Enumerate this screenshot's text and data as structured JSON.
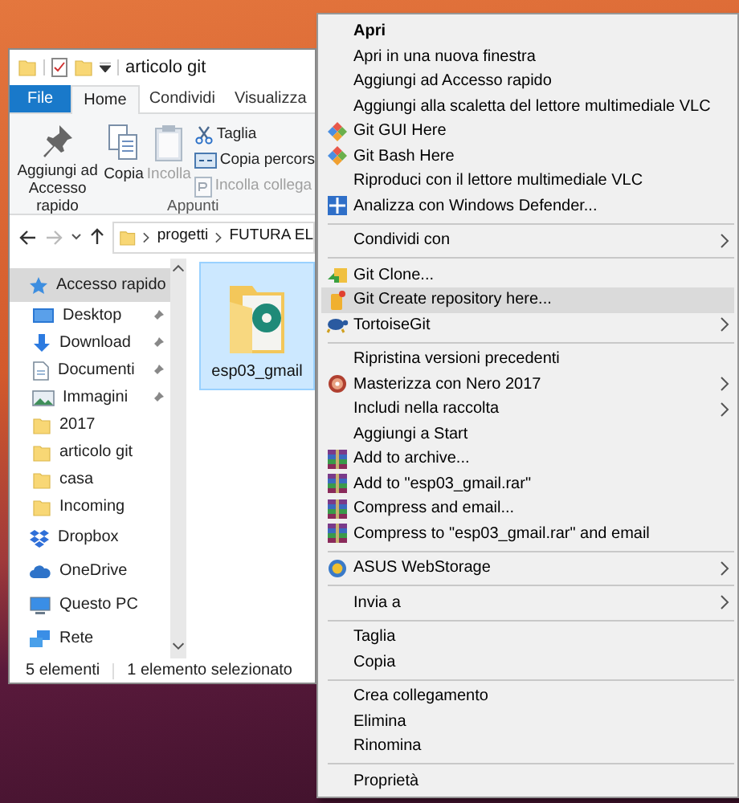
{
  "window": {
    "title": "articolo git"
  },
  "ribbon_tabs": [
    {
      "label": "File",
      "kind": "file",
      "selected": false
    },
    {
      "label": "Home",
      "kind": "tab",
      "selected": true
    },
    {
      "label": "Condividi",
      "kind": "tab",
      "selected": false
    },
    {
      "label": "Visualizza",
      "kind": "tab",
      "selected": false
    }
  ],
  "clipboard_group": {
    "label": "Appunti",
    "buttons": [
      {
        "label": "Aggiungi ad Accesso rapido",
        "kind": "pin",
        "disabled": false
      },
      {
        "label": "Copia",
        "kind": "copy",
        "disabled": false
      },
      {
        "label": "Incolla",
        "kind": "paste",
        "disabled": true
      }
    ],
    "small_buttons": [
      {
        "label": "Taglia",
        "kind": "cut",
        "disabled": false
      },
      {
        "label": "Copia percors",
        "kind": "path",
        "disabled": false
      },
      {
        "label": "Incolla collega",
        "kind": "shortcut",
        "disabled": true
      }
    ]
  },
  "address_bar": {
    "crumbs": [
      "progetti",
      "FUTURA EL"
    ]
  },
  "navigation": [
    {
      "label": "Accesso rapido",
      "kind": "star",
      "selected": true,
      "children": [
        {
          "label": "Desktop",
          "kind": "desktop",
          "pinned": true,
          "selected": false
        },
        {
          "label": "Download",
          "kind": "download",
          "pinned": true,
          "selected": false
        },
        {
          "label": "Documenti",
          "kind": "document",
          "pinned": true,
          "selected": false
        },
        {
          "label": "Immagini",
          "kind": "picture",
          "pinned": true,
          "selected": false
        },
        {
          "label": "2017",
          "kind": "folder",
          "pinned": false,
          "selected": false
        },
        {
          "label": "articolo git",
          "kind": "folder",
          "pinned": false,
          "selected": false
        },
        {
          "label": "casa",
          "kind": "folder",
          "pinned": false,
          "selected": false
        },
        {
          "label": "Incoming",
          "kind": "folder",
          "pinned": false,
          "selected": false
        }
      ]
    },
    {
      "label": "Dropbox",
      "kind": "dropbox",
      "selected": false
    },
    {
      "label": "OneDrive",
      "kind": "cloud",
      "selected": false
    },
    {
      "label": "Questo PC",
      "kind": "computer",
      "selected": false
    },
    {
      "label": "Rete",
      "kind": "network",
      "selected": false
    }
  ],
  "files": [
    {
      "name": "esp03_gmail",
      "selected": true
    }
  ],
  "status_bar": {
    "count": "5 elementi",
    "selection": "1 elemento selezionato"
  },
  "context_menu": {
    "sections": [
      [
        {
          "label": "Apri",
          "kind": "plain",
          "default": true,
          "selected": false,
          "submenu": false
        },
        {
          "label": "Apri in una nuova finestra",
          "kind": "plain",
          "default": false,
          "selected": false,
          "submenu": false
        },
        {
          "label": "Aggiungi ad Accesso rapido",
          "kind": "plain",
          "default": false,
          "selected": false,
          "submenu": false
        },
        {
          "label": "Aggiungi alla scaletta del lettore multimediale VLC",
          "kind": "plain",
          "default": false,
          "selected": false,
          "submenu": false
        },
        {
          "label": "Git GUI Here",
          "kind": "git",
          "default": false,
          "selected": false,
          "submenu": false
        },
        {
          "label": "Git Bash Here",
          "kind": "git",
          "default": false,
          "selected": false,
          "submenu": false
        },
        {
          "label": "Riproduci con il lettore multimediale VLC",
          "kind": "plain",
          "default": false,
          "selected": false,
          "submenu": false
        },
        {
          "label": "Analizza con Windows Defender...",
          "kind": "defender",
          "default": false,
          "selected": false,
          "submenu": false
        }
      ],
      [
        {
          "label": "Condividi con",
          "kind": "plain",
          "default": false,
          "selected": false,
          "submenu": true
        }
      ],
      [
        {
          "label": "Git Clone...",
          "kind": "clone",
          "default": false,
          "selected": false,
          "submenu": false
        },
        {
          "label": "Git Create repository here...",
          "kind": "repo",
          "default": false,
          "selected": true,
          "submenu": false
        },
        {
          "label": "TortoiseGit",
          "kind": "tortoise",
          "default": false,
          "selected": false,
          "submenu": true
        }
      ],
      [
        {
          "label": "Ripristina versioni precedenti",
          "kind": "plain",
          "default": false,
          "selected": false,
          "submenu": false
        },
        {
          "label": "Masterizza con Nero 2017",
          "kind": "disc",
          "default": false,
          "selected": false,
          "submenu": true
        },
        {
          "label": "Includi nella raccolta",
          "kind": "plain",
          "default": false,
          "selected": false,
          "submenu": true
        },
        {
          "label": "Aggiungi a Start",
          "kind": "plain",
          "default": false,
          "selected": false,
          "submenu": false
        },
        {
          "label": "Add to archive...",
          "kind": "archive",
          "default": false,
          "selected": false,
          "submenu": false
        },
        {
          "label": "Add to \"esp03_gmail.rar\"",
          "kind": "archive",
          "default": false,
          "selected": false,
          "submenu": false
        },
        {
          "label": "Compress and email...",
          "kind": "archive",
          "default": false,
          "selected": false,
          "submenu": false
        },
        {
          "label": "Compress to \"esp03_gmail.rar\" and email",
          "kind": "archive",
          "default": false,
          "selected": false,
          "submenu": false
        }
      ],
      [
        {
          "label": "ASUS WebStorage",
          "kind": "globe",
          "default": false,
          "selected": false,
          "submenu": true
        }
      ],
      [
        {
          "label": "Invia a",
          "kind": "plain",
          "default": false,
          "selected": false,
          "submenu": true
        }
      ],
      [
        {
          "label": "Taglia",
          "kind": "plain",
          "default": false,
          "selected": false,
          "submenu": false
        },
        {
          "label": "Copia",
          "kind": "plain",
          "default": false,
          "selected": false,
          "submenu": false
        }
      ],
      [
        {
          "label": "Crea collegamento",
          "kind": "plain",
          "default": false,
          "selected": false,
          "submenu": false
        },
        {
          "label": "Elimina",
          "kind": "plain",
          "default": false,
          "selected": false,
          "submenu": false
        },
        {
          "label": "Rinomina",
          "kind": "plain",
          "default": false,
          "selected": false,
          "submenu": false
        }
      ],
      [
        {
          "label": "Proprietà",
          "kind": "plain",
          "default": false,
          "selected": false,
          "submenu": false
        }
      ]
    ]
  }
}
